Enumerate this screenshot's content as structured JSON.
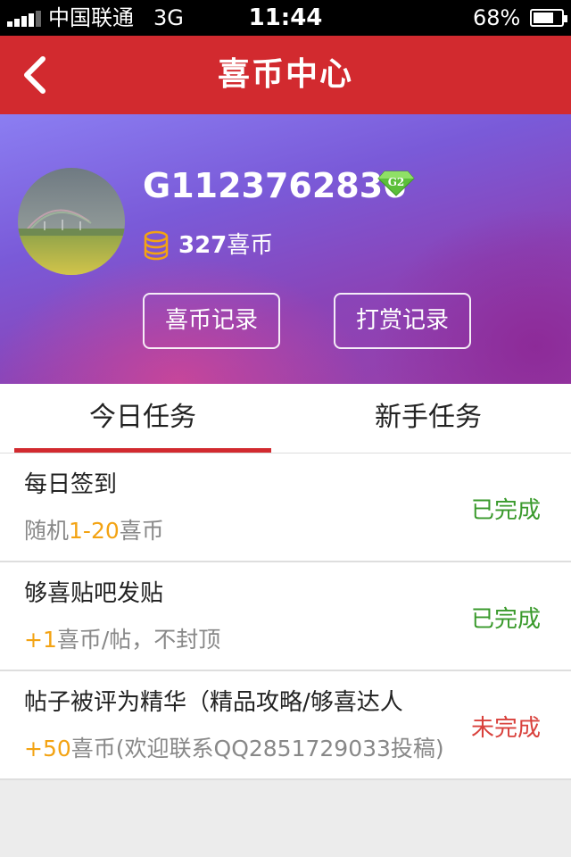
{
  "status_bar": {
    "carrier": "中国联通",
    "network": "3G",
    "time": "11:44",
    "battery": "68%"
  },
  "nav": {
    "title": "喜币中心"
  },
  "profile": {
    "username": "G1123762836",
    "level": "G2",
    "coin_amount": "327",
    "coin_unit": "喜币",
    "buttons": {
      "coin_record": "喜币记录",
      "reward_record": "打赏记录"
    }
  },
  "tabs": [
    {
      "label": "今日任务",
      "active": true
    },
    {
      "label": "新手任务",
      "active": false
    }
  ],
  "tasks": [
    {
      "title": "每日签到",
      "desc_prefix": "随机",
      "desc_highlight": "1-20",
      "desc_suffix": "喜币",
      "status": "已完成"
    },
    {
      "title": "够喜贴吧发贴",
      "desc_prefix": "",
      "desc_highlight": "+1",
      "desc_suffix": "喜币/帖，不封顶",
      "status": "已完成"
    },
    {
      "title": "帖子被评为精华（精品攻略/够喜达人",
      "desc_prefix": "",
      "desc_highlight": "+50",
      "desc_suffix": "喜币(欢迎联系QQ2851729033投稿)",
      "status": "未完成"
    }
  ],
  "colors": {
    "brand_red": "#d22a2f",
    "highlight_orange": "#f3a313",
    "done_green": "#3a9a2c",
    "pending_red": "#d9413c"
  },
  "icons": [
    "back-arrow-icon",
    "diamond-level-icon",
    "coin-stack-icon",
    "signal-icon",
    "battery-icon"
  ]
}
